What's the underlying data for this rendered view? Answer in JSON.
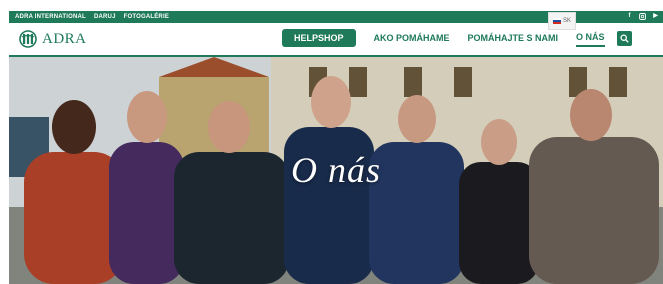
{
  "topbar": {
    "links": [
      "ADRA INTERNATIONAL",
      "DARUJ",
      "FOTOGALÉRIE"
    ],
    "social_icons": [
      "facebook-icon",
      "instagram-icon",
      "youtube-icon"
    ]
  },
  "language": {
    "code": "SK",
    "flag_colors": [
      "#ffffff",
      "#1d4fa0",
      "#d52b1e"
    ]
  },
  "logo": {
    "text": "ADRA",
    "color": "#1f7a5a"
  },
  "nav": {
    "helpshop": "HELPSHOP",
    "items": [
      "AKO POMÁHAME",
      "POMÁHAJTE S NAMI",
      "O NÁS"
    ],
    "active": "O NÁS"
  },
  "hero": {
    "title": "O nás"
  },
  "colors": {
    "brand_green": "#1f7a5a"
  }
}
